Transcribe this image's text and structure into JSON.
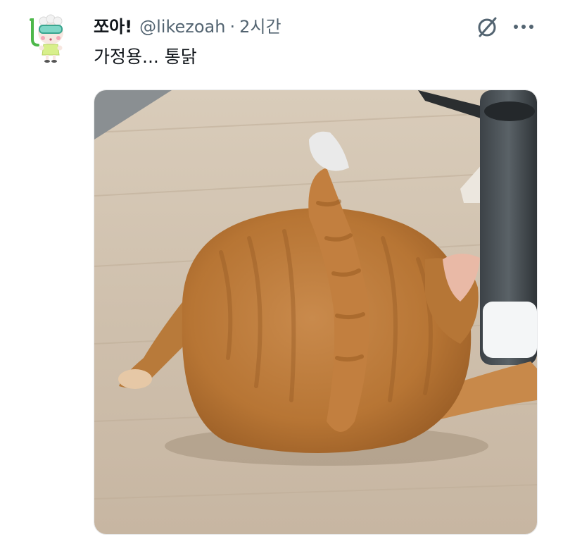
{
  "post": {
    "author": {
      "display_name": "쪼아!",
      "handle": "@likezoah",
      "avatar_icon": "snorkel-mascot-avatar-icon"
    },
    "separator": "·",
    "time": "2시간",
    "text": "가정용... 통닭",
    "icons": {
      "grok": "grok-slash-icon",
      "more": "more-horizontal-icon"
    },
    "media": {
      "type": "photo",
      "subject": "orange tabby cat curled up on wooden floor"
    }
  }
}
